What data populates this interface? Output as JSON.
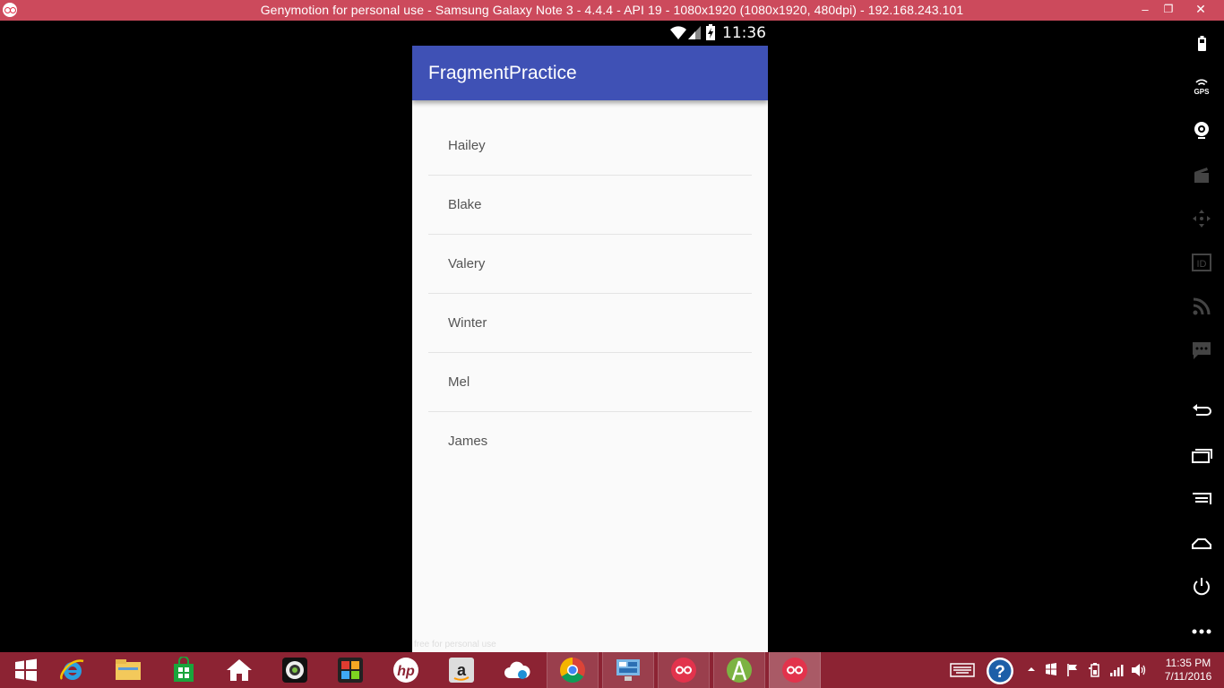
{
  "window": {
    "title": "Genymotion for personal use - Samsung Galaxy Note 3 - 4.4.4 - API 19 - 1080x1920 (1080x1920, 480dpi) - 192.168.243.101",
    "minimize": "–",
    "restore": "❐",
    "close": "✕"
  },
  "device": {
    "clock": "11:36",
    "app_title": "FragmentPractice",
    "names": [
      "Hailey",
      "Blake",
      "Valery",
      "Winter",
      "Mel",
      "James"
    ],
    "watermark": "free for personal use"
  },
  "sidebar": {
    "gps_label": "GPS",
    "tools": [
      "battery-icon",
      "gps-icon",
      "webcam-icon",
      "capture-icon",
      "remote-control-icon",
      "device-id-icon",
      "network-icon",
      "sms-icon",
      "back-icon",
      "recent-apps-icon",
      "menu-icon",
      "home-icon",
      "power-icon",
      "more-icon"
    ]
  },
  "taskbar": {
    "time": "11:35 PM",
    "date": "7/11/2016",
    "colors": {
      "accent": "#8c2333",
      "appbar": "#3f51b5",
      "titlebar": "#cc4a5c"
    }
  }
}
